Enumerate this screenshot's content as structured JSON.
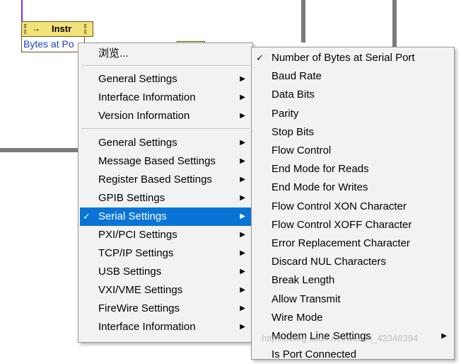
{
  "node": {
    "title": "Instr",
    "property": "Bytes at Po"
  },
  "context_menu": {
    "items": [
      {
        "label": "浏览...",
        "submenu": false,
        "checked": false
      },
      {
        "label": "General Settings",
        "submenu": true,
        "checked": false
      },
      {
        "label": "Interface Information",
        "submenu": true,
        "checked": false
      },
      {
        "label": "Version Information",
        "submenu": true,
        "checked": false
      },
      {
        "label": "General Settings",
        "submenu": true,
        "checked": false
      },
      {
        "label": "Message Based Settings",
        "submenu": true,
        "checked": false
      },
      {
        "label": "Register Based Settings",
        "submenu": true,
        "checked": false
      },
      {
        "label": "GPIB Settings",
        "submenu": true,
        "checked": false
      },
      {
        "label": "Serial Settings",
        "submenu": true,
        "checked": true,
        "selected": true
      },
      {
        "label": "PXI/PCI Settings",
        "submenu": true,
        "checked": false
      },
      {
        "label": "TCP/IP Settings",
        "submenu": true,
        "checked": false
      },
      {
        "label": "USB Settings",
        "submenu": true,
        "checked": false
      },
      {
        "label": "VXI/VME Settings",
        "submenu": true,
        "checked": false
      },
      {
        "label": "FireWire Settings",
        "submenu": true,
        "checked": false
      },
      {
        "label": "Interface Information",
        "submenu": true,
        "checked": false
      }
    ]
  },
  "serial_submenu": {
    "items": [
      {
        "label": "Number of Bytes at Serial Port",
        "checked": true
      },
      {
        "label": "Baud Rate"
      },
      {
        "label": "Data Bits"
      },
      {
        "label": "Parity"
      },
      {
        "label": "Stop Bits"
      },
      {
        "label": "Flow Control"
      },
      {
        "label": "End Mode for Reads"
      },
      {
        "label": "End Mode for Writes"
      },
      {
        "label": "Flow Control XON Character"
      },
      {
        "label": "Flow Control XOFF Character"
      },
      {
        "label": "Error Replacement Character"
      },
      {
        "label": "Discard NUL Characters"
      },
      {
        "label": "Break Length"
      },
      {
        "label": "Allow Transmit"
      },
      {
        "label": "Wire Mode"
      },
      {
        "label": "Modem Line Settings",
        "submenu": true
      },
      {
        "label": "Is Port Connected"
      }
    ]
  },
  "watermark": "https://blog.csdn.net/weixin_43348394",
  "colors": {
    "selection": "#0a74d6",
    "menu_bg": "#f2f2f2",
    "property_text": "#1f3fbf",
    "node_fill": "#f2e27a"
  },
  "glyphs": {
    "check": "✓",
    "submenu_arrow": "▶",
    "wire_arrow": "→"
  }
}
